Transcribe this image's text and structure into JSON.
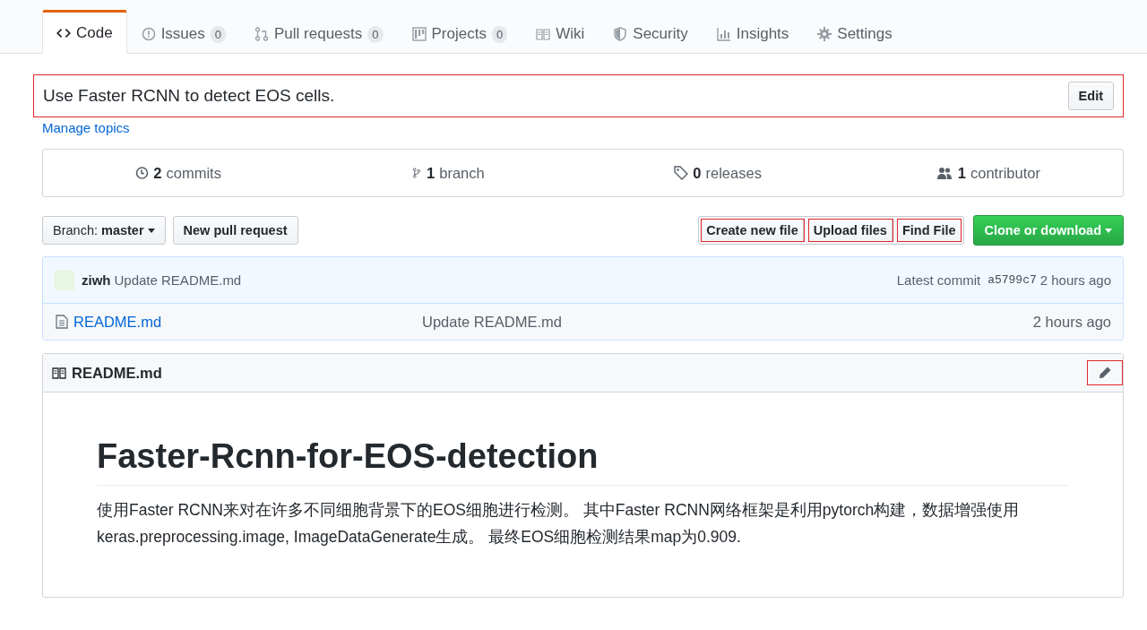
{
  "tabs": [
    {
      "label": "Code",
      "selected": true
    },
    {
      "label": "Issues",
      "count": "0",
      "selected": false
    },
    {
      "label": "Pull requests",
      "count": "0",
      "selected": false
    },
    {
      "label": "Projects",
      "count": "0",
      "selected": false
    },
    {
      "label": "Wiki",
      "selected": false
    },
    {
      "label": "Security",
      "selected": false
    },
    {
      "label": "Insights",
      "selected": false
    },
    {
      "label": "Settings",
      "selected": false
    }
  ],
  "description": {
    "text": "Use Faster RCNN to detect EOS cells.",
    "highlighted": true,
    "edit_label": "Edit",
    "edit_highlighted": false
  },
  "manage_topics": "Manage topics",
  "stats": [
    {
      "value": "2",
      "label": "commits"
    },
    {
      "value": "1",
      "label": "branch"
    },
    {
      "value": "0",
      "label": "releases"
    },
    {
      "value": "1",
      "label": "contributor"
    }
  ],
  "branch_button": {
    "label": "Branch:",
    "value": "master"
  },
  "new_pull_request": "New pull request",
  "file_buttons": [
    {
      "label": "Create new file",
      "highlighted": true
    },
    {
      "label": "Upload files",
      "highlighted": true
    },
    {
      "label": "Find File",
      "highlighted": true
    }
  ],
  "clone_button": "Clone or download",
  "commit": {
    "author": "ziwh",
    "message": "Update README.md",
    "latest_label": "Latest commit",
    "sha": "a5799c7",
    "time": "2 hours ago"
  },
  "files": [
    {
      "name": "README.md",
      "message": "Update README.md",
      "time": "2 hours ago"
    }
  ],
  "readme": {
    "title": "README.md",
    "edit_highlighted": true,
    "heading": "Faster-Rcnn-for-EOS-detection",
    "paragraph": "使用Faster RCNN来对在许多不同细胞背景下的EOS细胞进行检测。 其中Faster RCNN网络框架是利用pytorch构建，数据增强使用keras.preprocessing.image, ImageDataGenerate生成。 最终EOS细胞检测结果map为0.909."
  }
}
